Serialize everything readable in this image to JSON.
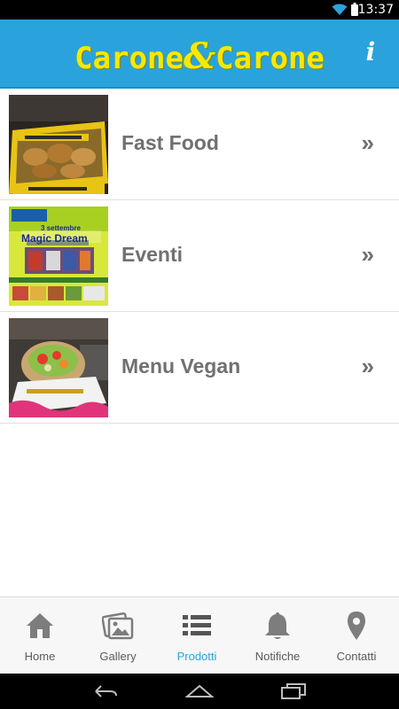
{
  "status_bar": {
    "time": "13:37"
  },
  "app": {
    "logo_left": "Carone",
    "logo_amp": "&",
    "logo_right": "Carone",
    "info_glyph": "i",
    "brand_color": "#2aa3dc",
    "logo_color": "#f5e900"
  },
  "list": {
    "items": [
      {
        "label": "Fast Food",
        "chevron": "»"
      },
      {
        "label": "Eventi",
        "chevron": "»"
      },
      {
        "label": "Menu Vegan",
        "chevron": "»"
      }
    ],
    "event_poster": {
      "line1": "3 settembre",
      "line2": "Magic Dream"
    }
  },
  "bottom_nav": {
    "items": [
      {
        "label": "Home",
        "icon": "home-icon"
      },
      {
        "label": "Gallery",
        "icon": "gallery-icon"
      },
      {
        "label": "Prodotti",
        "icon": "list-icon",
        "active": true
      },
      {
        "label": "Notifiche",
        "icon": "bell-icon"
      },
      {
        "label": "Contatti",
        "icon": "location-pin-icon"
      }
    ]
  },
  "system_nav": {
    "icons": [
      "back-icon",
      "home-outline-icon",
      "recents-icon"
    ]
  }
}
